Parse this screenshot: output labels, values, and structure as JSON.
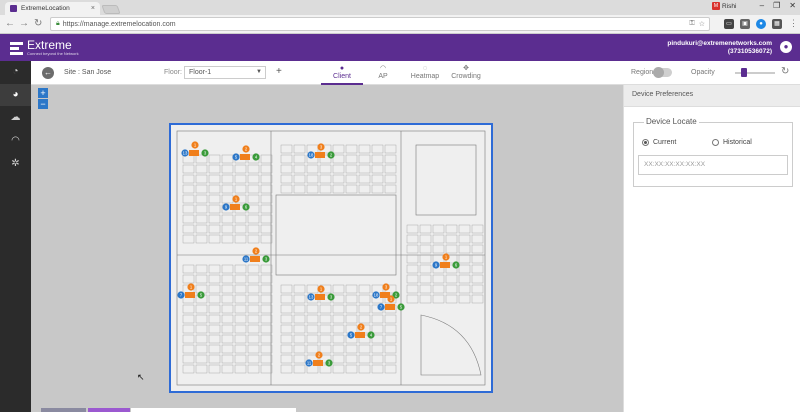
{
  "browser": {
    "tab_title": "ExtremeLocation",
    "tab_close": "×",
    "profile_name": "Rishi",
    "profile_badge": "M",
    "url": "https://manage.extremelocation.com",
    "win_min": "–",
    "win_max": "❐",
    "win_close": "✕"
  },
  "header": {
    "brand": "Extreme",
    "brand_tagline": "Connect beyond the Network",
    "user_email": "pindukuri@extremenetworks.com",
    "user_id": "(37310536072)"
  },
  "toolbar": {
    "site_label": "Site : San Jose",
    "floor_label": "Floor:",
    "floor_value": "Floor-1",
    "add": "+",
    "tabs": [
      {
        "label": "Client",
        "icon": "person-icon"
      },
      {
        "label": "AP",
        "icon": "wifi-icon"
      },
      {
        "label": "Heatmap",
        "icon": "heatmap-icon"
      },
      {
        "label": "Crowding",
        "icon": "crowding-icon"
      }
    ],
    "region_label": "Region",
    "opacity_label": "Opacity"
  },
  "panel": {
    "header": "Device Preferences",
    "section_title": "Device Locate",
    "option_current": "Current",
    "option_historical": "Historical",
    "mac_placeholder": "XX:XX:XX:XX:XX:XX"
  },
  "map": {
    "zoom_in": "+",
    "zoom_out": "−",
    "badges": [
      {
        "cluster": "13",
        "visitor": "1",
        "client": "3"
      },
      {
        "cluster": "5",
        "visitor": "2",
        "client": "4"
      },
      {
        "cluster": "18",
        "visitor": "3",
        "client": "2"
      },
      {
        "cluster": "9",
        "visitor": "1",
        "client": "6"
      },
      {
        "cluster": "11",
        "visitor": "2",
        "client": "3"
      },
      {
        "cluster": "7",
        "visitor": "1",
        "client": "5"
      }
    ]
  },
  "colors": {
    "brand_purple": "#5b2d90",
    "plan_border": "#2e6bd6",
    "marker_blue": "#2c77c8",
    "marker_orange": "#f07f1c",
    "marker_green": "#3a9b3a"
  }
}
